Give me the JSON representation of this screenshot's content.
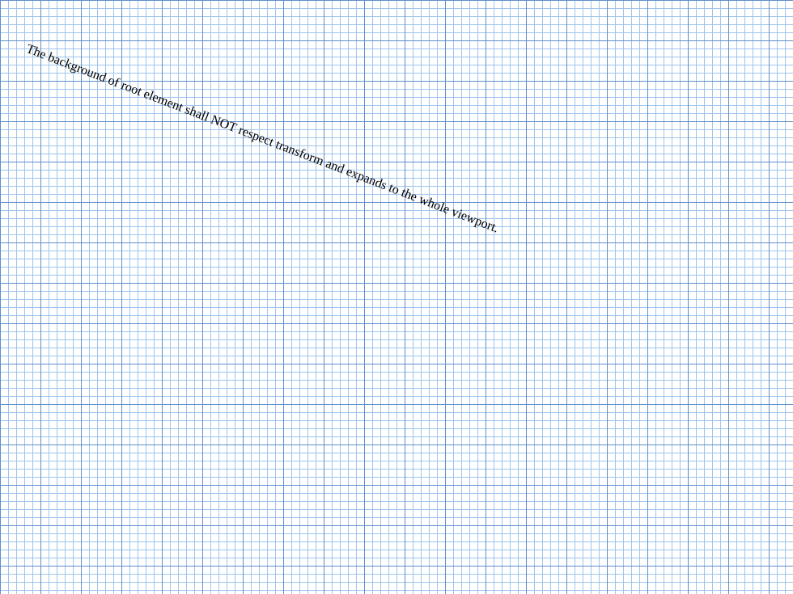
{
  "document": {
    "text": "The background of root element shall NOT respect transform and expands to the whole viewport."
  },
  "colors": {
    "background": "#ffffff",
    "major_grid_line": "#5f8fca",
    "minor_grid_line": "#9fc4ef",
    "text": "#000000"
  }
}
